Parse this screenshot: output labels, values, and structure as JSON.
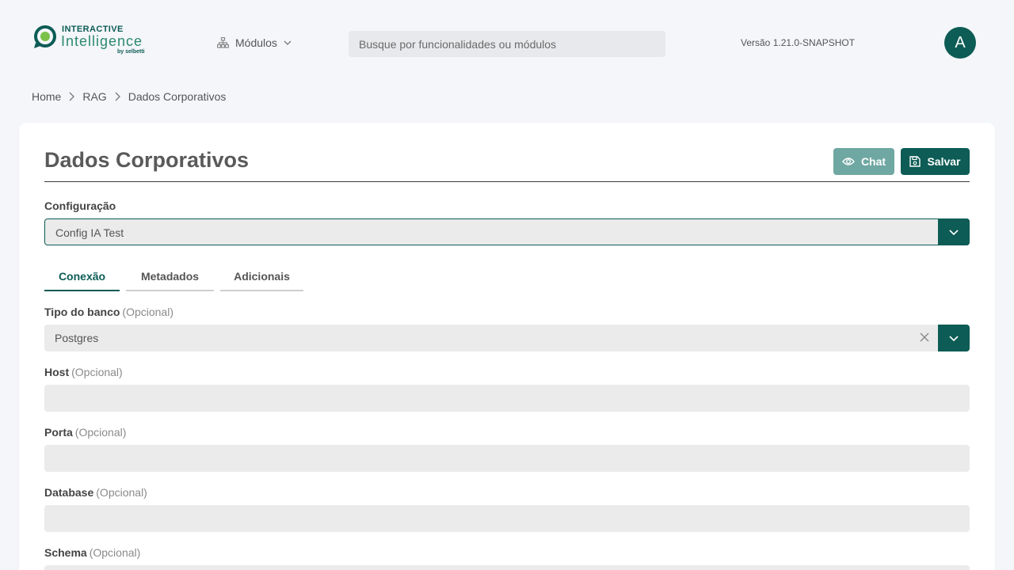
{
  "header": {
    "logo": {
      "line1": "INTERACTIVE",
      "line2": "Intelligence",
      "line3": "by selbetti"
    },
    "modules_label": "Módulos",
    "search_placeholder": "Busque por funcionalidades ou módulos",
    "version": "Versão 1.21.0-SNAPSHOT",
    "avatar_initial": "A"
  },
  "breadcrumb": [
    "Home",
    "RAG",
    "Dados Corporativos"
  ],
  "page": {
    "title": "Dados Corporativos",
    "chat_label": "Chat",
    "save_label": "Salvar"
  },
  "config": {
    "label": "Configuração",
    "value": "Config IA Test"
  },
  "tabs": [
    "Conexão",
    "Metadados",
    "Adicionais"
  ],
  "fields": {
    "optional": "(Opcional)",
    "db_type": {
      "label": "Tipo do banco",
      "value": "Postgres"
    },
    "host": {
      "label": "Host",
      "value": ""
    },
    "port": {
      "label": "Porta",
      "value": ""
    },
    "database": {
      "label": "Database",
      "value": ""
    },
    "schema": {
      "label": "Schema",
      "value": ""
    }
  },
  "colors": {
    "primary": "#0d5c55",
    "primary_light": "#6fa7a2",
    "background": "#f4f6fa"
  }
}
